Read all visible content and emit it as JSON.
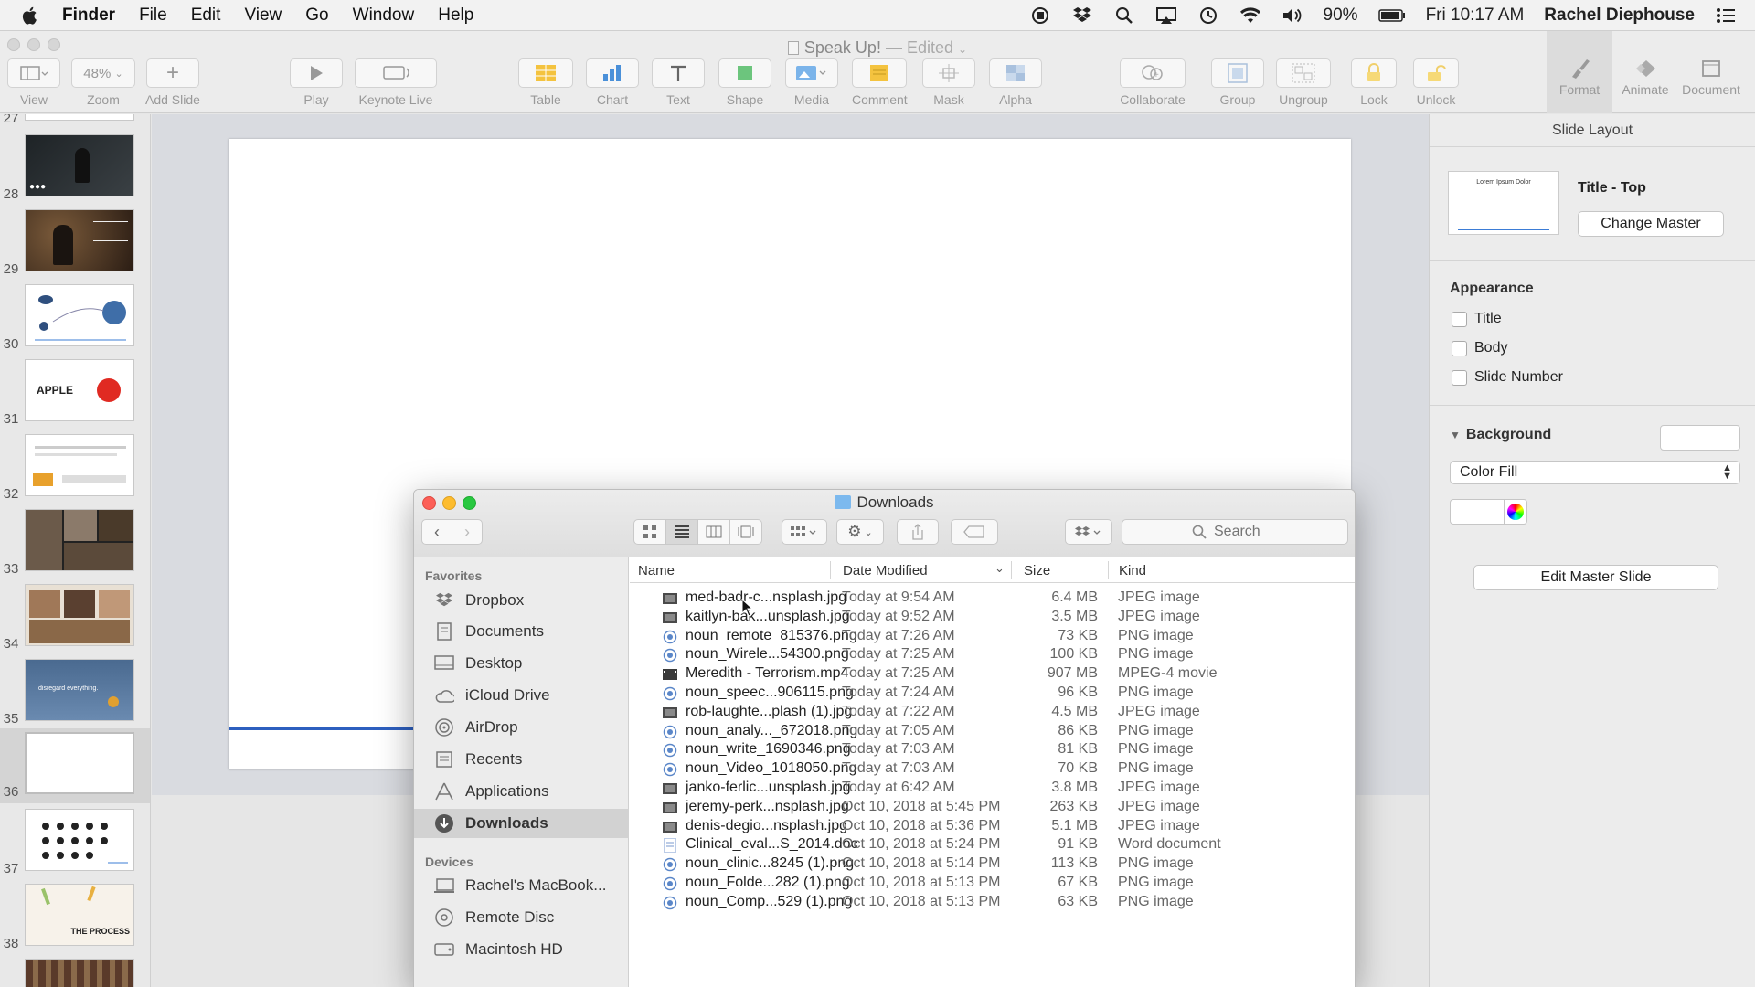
{
  "menubar": {
    "app": "Finder",
    "items": [
      "File",
      "Edit",
      "View",
      "Go",
      "Window",
      "Help"
    ],
    "battery": "90%",
    "clock": "Fri 10:17 AM",
    "user": "Rachel Diephouse"
  },
  "keynote": {
    "title": "Speak Up!",
    "edited": "— Edited",
    "zoom": "48%",
    "toolbar": {
      "view": "View",
      "zoom": "Zoom",
      "add_slide": "Add Slide",
      "play": "Play",
      "keynote_live": "Keynote Live",
      "table": "Table",
      "chart": "Chart",
      "text": "Text",
      "shape": "Shape",
      "media": "Media",
      "comment": "Comment",
      "mask": "Mask",
      "alpha": "Alpha",
      "collaborate": "Collaborate",
      "group": "Group",
      "ungroup": "Ungroup",
      "lock": "Lock",
      "unlock": "Unlock",
      "format": "Format",
      "animate": "Animate",
      "document": "Document"
    },
    "slides": [
      "27",
      "28",
      "29",
      "30",
      "31",
      "32",
      "33",
      "34",
      "35",
      "36",
      "37",
      "38"
    ],
    "thumb_texts": {
      "s31": "APPLE",
      "s35": "disregard everything.",
      "s38": "THE PROCESS"
    },
    "inspector": {
      "header": "Slide Layout",
      "master_thumb_text": "Lorem Ipsum Dolor",
      "master_name": "Title - Top",
      "change_master": "Change Master",
      "appearance": "Appearance",
      "opt_title": "Title",
      "opt_body": "Body",
      "opt_slide_number": "Slide Number",
      "background": "Background",
      "fill": "Color Fill",
      "edit_master": "Edit Master Slide"
    }
  },
  "finder": {
    "title": "Downloads",
    "search_placeholder": "Search",
    "favorites_label": "Favorites",
    "favorites": [
      "Dropbox",
      "Documents",
      "Desktop",
      "iCloud Drive",
      "AirDrop",
      "Recents",
      "Applications",
      "Downloads"
    ],
    "devices_label": "Devices",
    "devices": [
      "Rachel's MacBook...",
      "Remote Disc",
      "Macintosh HD"
    ],
    "columns": {
      "name": "Name",
      "date": "Date Modified",
      "size": "Size",
      "kind": "Kind"
    },
    "files": [
      {
        "name": "med-badr-c...nsplash.jpg",
        "date": "Today at 9:54 AM",
        "size": "6.4 MB",
        "kind": "JPEG image"
      },
      {
        "name": "kaitlyn-bak...unsplash.jpg",
        "date": "Today at 9:52 AM",
        "size": "3.5 MB",
        "kind": "JPEG image"
      },
      {
        "name": "noun_remote_815376.png",
        "date": "Today at 7:26 AM",
        "size": "73 KB",
        "kind": "PNG image"
      },
      {
        "name": "noun_Wirele...54300.png",
        "date": "Today at 7:25 AM",
        "size": "100 KB",
        "kind": "PNG image"
      },
      {
        "name": "Meredith - Terrorism.mp4",
        "date": "Today at 7:25 AM",
        "size": "907 MB",
        "kind": "MPEG-4 movie"
      },
      {
        "name": "noun_speec...906115.png",
        "date": "Today at 7:24 AM",
        "size": "96 KB",
        "kind": "PNG image"
      },
      {
        "name": "rob-laughte...plash (1).jpg",
        "date": "Today at 7:22 AM",
        "size": "4.5 MB",
        "kind": "JPEG image"
      },
      {
        "name": "noun_analy..._672018.png",
        "date": "Today at 7:05 AM",
        "size": "86 KB",
        "kind": "PNG image"
      },
      {
        "name": "noun_write_1690346.png",
        "date": "Today at 7:03 AM",
        "size": "81 KB",
        "kind": "PNG image"
      },
      {
        "name": "noun_Video_1018050.png",
        "date": "Today at 7:03 AM",
        "size": "70 KB",
        "kind": "PNG image"
      },
      {
        "name": "janko-ferlic...unsplash.jpg",
        "date": "Today at 6:42 AM",
        "size": "3.8 MB",
        "kind": "JPEG image"
      },
      {
        "name": "jeremy-perk...nsplash.jpg",
        "date": "Oct 10, 2018 at 5:45 PM",
        "size": "263 KB",
        "kind": "JPEG image"
      },
      {
        "name": "denis-degio...nsplash.jpg",
        "date": "Oct 10, 2018 at 5:36 PM",
        "size": "5.1 MB",
        "kind": "JPEG image"
      },
      {
        "name": "Clinical_eval...S_2014.doc",
        "date": "Oct 10, 2018 at 5:24 PM",
        "size": "91 KB",
        "kind": "Word document"
      },
      {
        "name": "noun_clinic...8245 (1).png",
        "date": "Oct 10, 2018 at 5:14 PM",
        "size": "113 KB",
        "kind": "PNG image"
      },
      {
        "name": "noun_Folde...282 (1).png",
        "date": "Oct 10, 2018 at 5:13 PM",
        "size": "67 KB",
        "kind": "PNG image"
      },
      {
        "name": "noun_Comp...529 (1).png",
        "date": "Oct 10, 2018 at 5:13 PM",
        "size": "63 KB",
        "kind": "PNG image"
      }
    ]
  },
  "colors": {
    "accent_blue": "#2d5fbf",
    "selection": "#d2d2d2"
  }
}
